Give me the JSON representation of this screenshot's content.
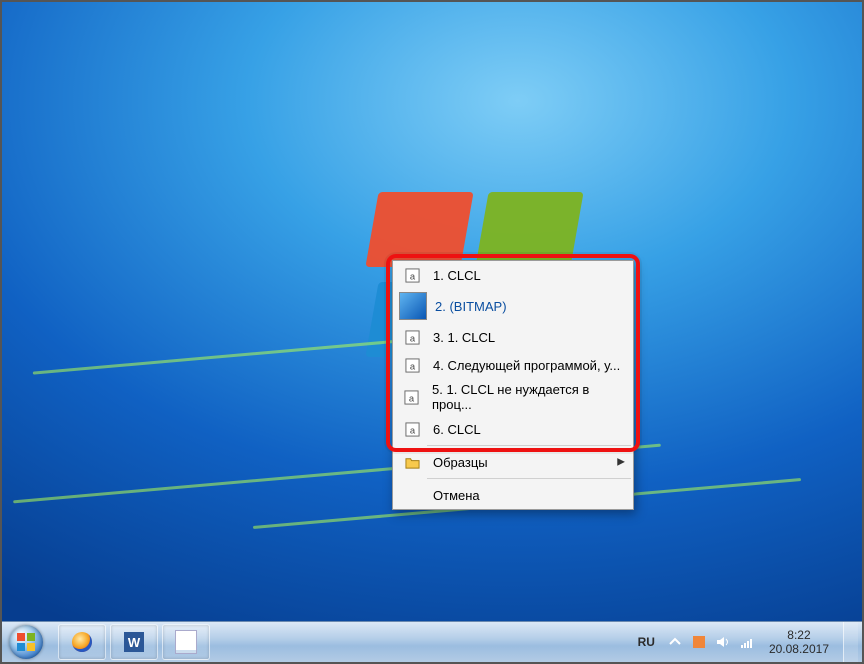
{
  "menu": {
    "items": [
      {
        "n": "1",
        "label": "CLCL",
        "type": "text"
      },
      {
        "n": "2",
        "label": "(BITMAP)",
        "type": "bitmap"
      },
      {
        "n": "3",
        "label": "1. CLCL",
        "type": "text"
      },
      {
        "n": "4",
        "label": "Следующей программой, у...",
        "type": "text"
      },
      {
        "n": "5",
        "label": "1. CLCL не нуждается в проц...",
        "type": "text"
      },
      {
        "n": "6",
        "label": "CLCL",
        "type": "text"
      }
    ],
    "samples_label": "Образцы",
    "cancel_label": "Отмена"
  },
  "taskbar": {
    "tray": {
      "lang": "RU",
      "time": "8:22",
      "date": "20.08.2017"
    }
  }
}
